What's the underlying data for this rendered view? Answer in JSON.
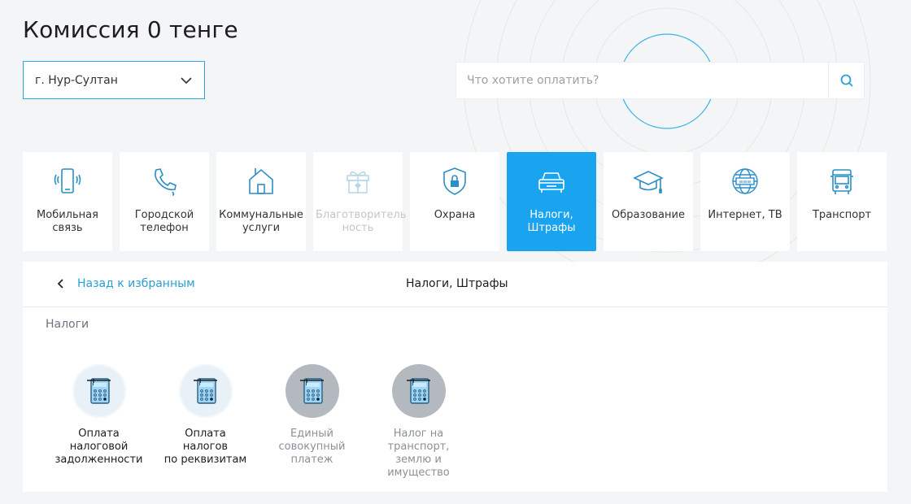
{
  "page": {
    "title": "Комиссия 0 тенге"
  },
  "city_select": {
    "value": "г. Нур-Султан",
    "icon": "chevron-down-icon"
  },
  "search": {
    "placeholder": "Что хотите оплатить?",
    "icon": "search-icon"
  },
  "colors": {
    "accent": "#1aa3ef",
    "link": "#2a9fd6",
    "icon_blue": "#2a8fc8"
  },
  "categories": [
    {
      "label": "Мобильная\nсвязь",
      "icon": "mobile-phone-icon",
      "state": "normal"
    },
    {
      "label": "Городской\nтелефон",
      "icon": "landline-phone-icon",
      "state": "normal"
    },
    {
      "label": "Коммунальные\nуслуги",
      "icon": "house-icon",
      "state": "normal"
    },
    {
      "label": "Благотворитель\nность",
      "icon": "gift-icon",
      "state": "disabled"
    },
    {
      "label": "Охрана",
      "icon": "shield-lock-icon",
      "state": "normal"
    },
    {
      "label": "Налоги,\nШтрафы",
      "icon": "car-icon",
      "state": "active"
    },
    {
      "label": "Образование",
      "icon": "graduation-cap-icon",
      "state": "normal"
    },
    {
      "label": "Интернет, ТВ",
      "icon": "globe-icon",
      "state": "normal"
    },
    {
      "label": "Транспорт",
      "icon": "bus-icon",
      "state": "normal"
    }
  ],
  "panel": {
    "back_label": "Назад к избранным",
    "title": "Налоги, Штрафы",
    "section_label": "Налоги",
    "services": [
      {
        "label": "Оплата\nналоговой\nзадолженности",
        "icon": "calculator-icon",
        "state": "enabled"
      },
      {
        "label": "Оплата налогов\nпо реквизитам",
        "icon": "calculator-icon",
        "state": "enabled"
      },
      {
        "label": "Единый\nсовокупный\nплатеж",
        "icon": "calculator-icon",
        "state": "disabled"
      },
      {
        "label": "Налог на\nтранспорт,\nземлю и\nимущество",
        "icon": "calculator-icon",
        "state": "disabled"
      }
    ]
  }
}
